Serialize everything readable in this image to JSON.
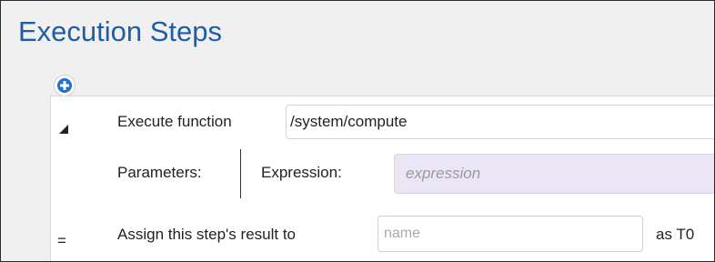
{
  "section": {
    "title": "Execution Steps"
  },
  "toolbar": {
    "add_icon": "plus-icon"
  },
  "step": {
    "collapse_icon": "triangle-collapse-icon",
    "execute_label": "Execute function",
    "function_value": "/system/compute",
    "parameters_label": "Parameters:",
    "expression_label": "Expression:",
    "expression_placeholder": "expression",
    "assign_icon": "=",
    "assign_label": "Assign this step's result to",
    "name_placeholder": "name",
    "as_label": "as T0"
  },
  "colors": {
    "title": "#1f5da6",
    "add_icon": "#1f73c6",
    "expression_bg": "#eae6f6",
    "background": "#f0f0f0"
  }
}
